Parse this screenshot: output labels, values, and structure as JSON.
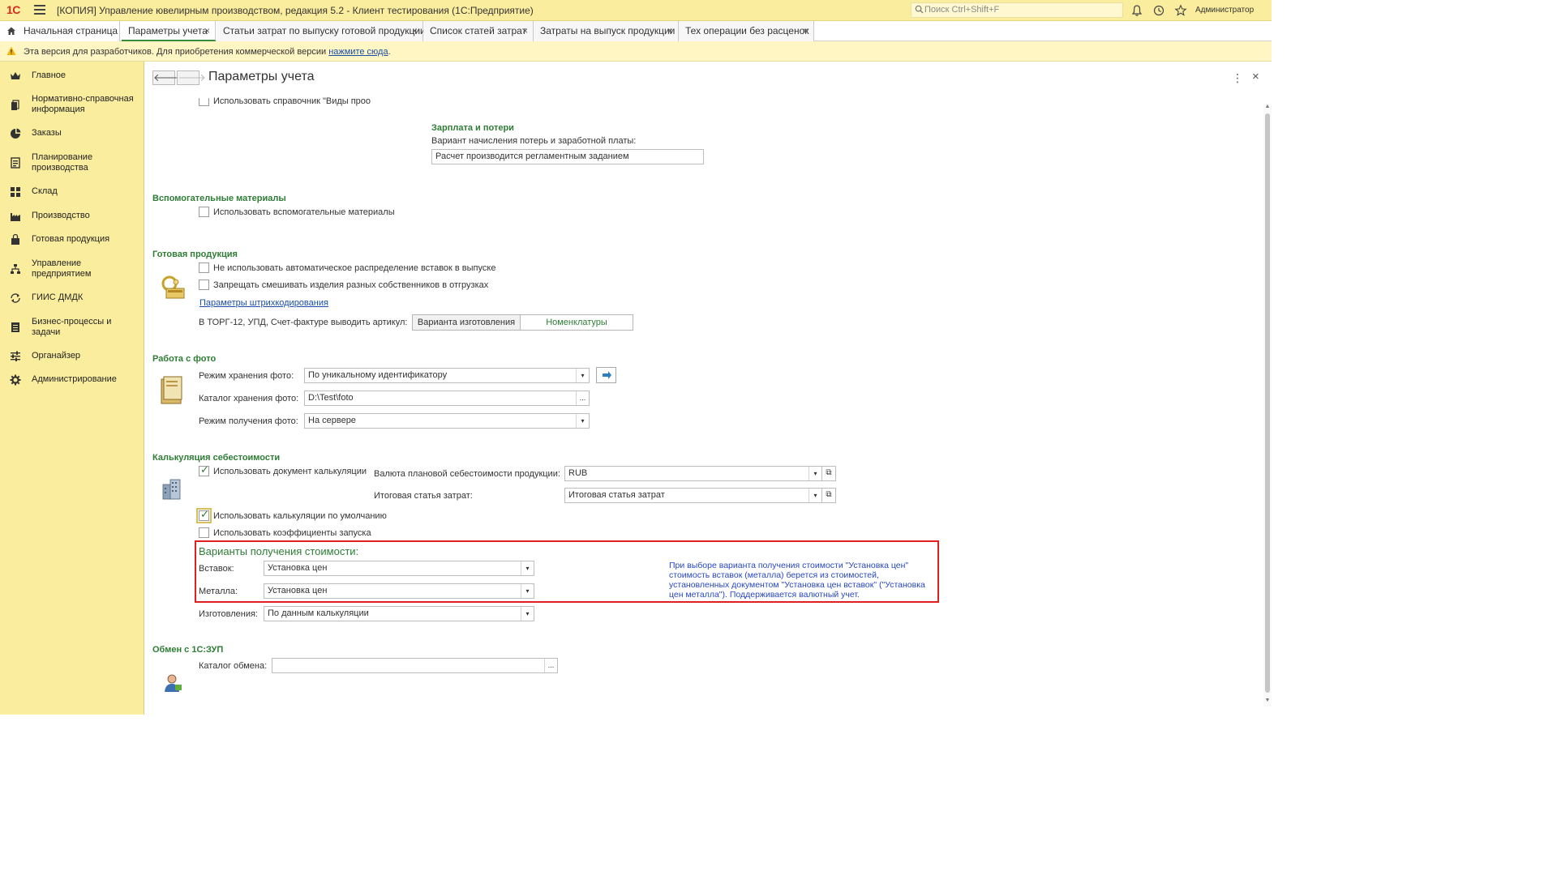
{
  "titlebar": {
    "logo": "1С",
    "title": "[КОПИЯ] Управление ювелирным производством, редакция 5.2  - Клиент тестирования (1С:Предприятие)",
    "search_placeholder": "Поиск Ctrl+Shift+F",
    "user": "Администратор"
  },
  "tabs": [
    {
      "label": "Начальная страница"
    },
    {
      "label": "Параметры учета",
      "close": "×"
    },
    {
      "label": "Статьи затрат по выпуску готовой продукции",
      "close": "×"
    },
    {
      "label": "Список статей затрат",
      "close": "×"
    },
    {
      "label": "Затраты на выпуск продукции",
      "close": "×"
    },
    {
      "label": "Тех операции без расценок",
      "close": "×"
    }
  ],
  "notice": {
    "text": "Эта версия для разработчиков. Для приобретения коммерческой версии ",
    "link": "нажмите сюда",
    "tail": "."
  },
  "sidebar": {
    "items": [
      {
        "label": "Главное",
        "icon": "crown-icon"
      },
      {
        "label": "Нормативно-справочная информация",
        "icon": "books-icon"
      },
      {
        "label": "Заказы",
        "icon": "pie-icon"
      },
      {
        "label": "Планирование производства",
        "icon": "plan-icon"
      },
      {
        "label": "Склад",
        "icon": "grid-icon"
      },
      {
        "label": "Производство",
        "icon": "factory-icon"
      },
      {
        "label": "Готовая продукция",
        "icon": "bag-icon"
      },
      {
        "label": "Управление предприятием",
        "icon": "org-icon"
      },
      {
        "label": "ГИИС ДМДК",
        "icon": "sync-icon"
      },
      {
        "label": "Бизнес-процессы и задачи",
        "icon": "tasks-icon"
      },
      {
        "label": "Органайзер",
        "icon": "sliders-icon"
      },
      {
        "label": "Администрирование",
        "icon": "gear-icon"
      }
    ]
  },
  "page": {
    "title": "Параметры учета",
    "back": "🡐",
    "forward": "🡒",
    "more": "⋮",
    "close": "×"
  },
  "form": {
    "cut_checkbox_label": "Использовать справочник \"Виды проо",
    "salary": {
      "title": "Зарплата и потери",
      "label": "Вариант начисления потерь и заработной платы:",
      "value": "Расчет производится регламентным заданием"
    },
    "aux": {
      "title": "Вспомогательные материалы",
      "cb_label": "Использовать вспомогательные материалы"
    },
    "finished": {
      "title": "Готовая продукция",
      "cb1_label": "Не использовать автоматическое распределение вставок в выпуске",
      "cb2_label": "Запрещать смешивать изделия разных собственников в отгрузках",
      "link": "Параметры штрихкодирования",
      "article_label": "В ТОРГ-12, УПД, Счет-фактуре выводить артикул:",
      "seg1": "Варианта изготовления",
      "seg2": "Номенклатуры"
    },
    "photo": {
      "title": "Работа с фото",
      "mode_label": "Режим хранения фото:",
      "mode_value": "По уникальному идентификатору",
      "dir_label": "Каталог хранения фото:",
      "dir_value": "D:\\Test\\foto",
      "get_label": "Режим получения фото:",
      "get_value": "На сервере"
    },
    "costing": {
      "title": "Калькуляция себестоимости",
      "cb_doc_label": "Использовать документ калькуляции",
      "currency_label": "Валюта плановой себестоимости продукции:",
      "currency_value": "RUB",
      "total_label": "Итоговая статья затрат:",
      "total_value": "Итоговая статья затрат",
      "cb_default_label": "Использовать калькуляции по умолчанию",
      "cb_coef_label": "Использовать коэффициенты запуска",
      "variants_title": "Варианты получения стоимости:",
      "inserts_label": "Вставок:",
      "inserts_value": "Установка цен",
      "metal_label": "Металла:",
      "metal_value": "Установка цен",
      "make_label": "Изготовления:",
      "make_value": "По данным калькуляции",
      "hint": "При выборе варианта получения стоимости \"Установка цен\" стоимость вставок (металла) берется из стоимостей, установленных документом \"Установка цен вставок\" (\"Установка цен металла\"). Поддерживается валютный учет."
    },
    "exchange": {
      "title": "Обмен с 1С:ЗУП",
      "dir_label": "Каталог обмена:",
      "dir_value": ""
    }
  },
  "common": {
    "dropdown_glyph": "▾",
    "dots": "...",
    "open_glyph": "⧉",
    "checkmark": "✓"
  }
}
